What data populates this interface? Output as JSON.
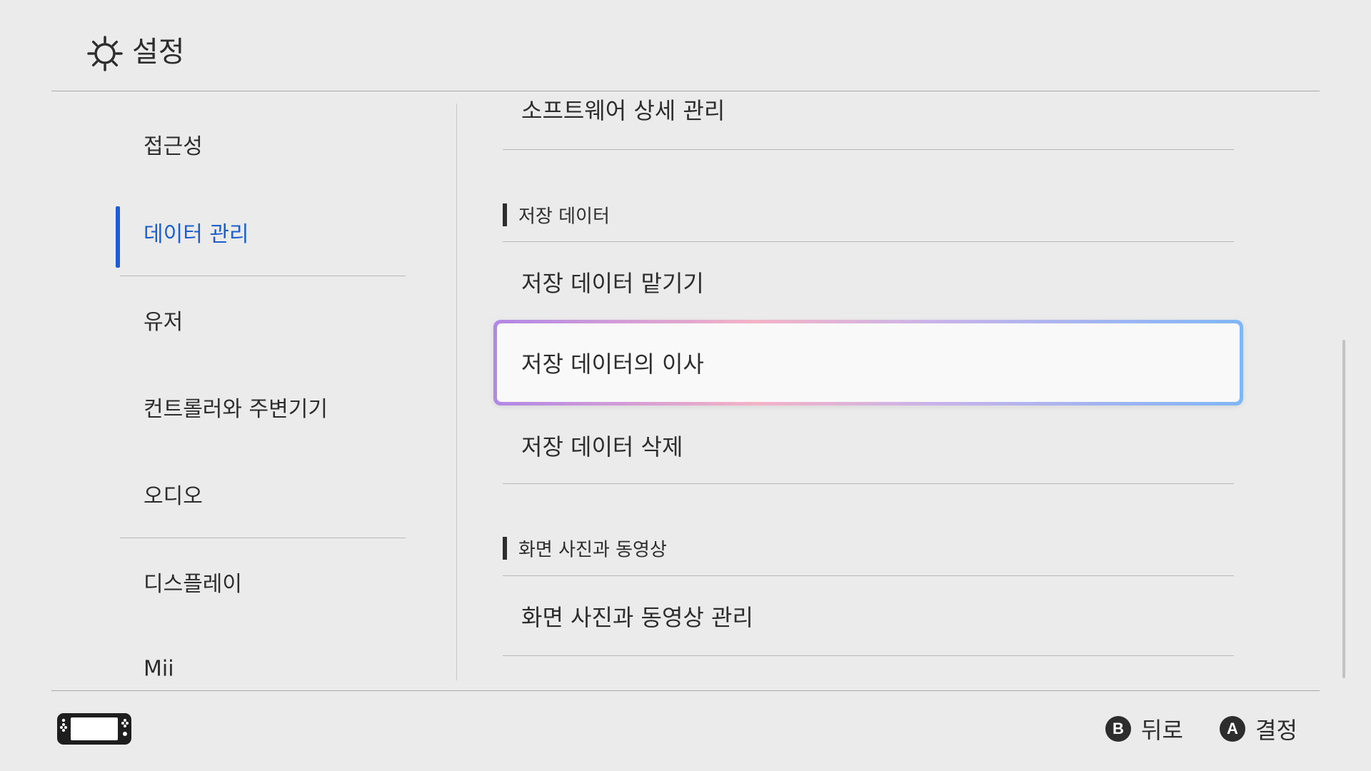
{
  "header": {
    "icon": "gear-icon",
    "title": "설정"
  },
  "sidebar": {
    "items": [
      {
        "label": "접근성",
        "active": false
      },
      {
        "label": "데이터 관리",
        "active": true
      },
      {
        "label": "유저",
        "active": false
      },
      {
        "label": "컨트롤러와 주변기기",
        "active": false
      },
      {
        "label": "오디오",
        "active": false
      },
      {
        "label": "디스플레이",
        "active": false
      },
      {
        "label": "Mii",
        "active": false
      }
    ],
    "accent_color": "#1b5fcf"
  },
  "main": {
    "software_row": "소프트웨어 상세 관리",
    "save_section": {
      "title": "저장 데이터",
      "items": [
        "저장 데이터 맡기기",
        "저장 데이터의 이사",
        "저장 데이터 삭제"
      ],
      "selected_index": 1
    },
    "media_section": {
      "title": "화면 사진과 동영상",
      "items": [
        "화면 사진과 동영상 관리"
      ]
    }
  },
  "footer": {
    "console_icon": "console-icon",
    "hints": [
      {
        "button": "B",
        "label": "뒤로"
      },
      {
        "button": "A",
        "label": "결정"
      }
    ]
  }
}
